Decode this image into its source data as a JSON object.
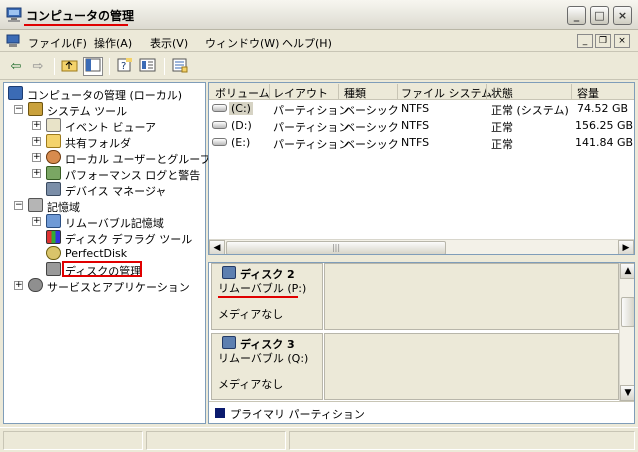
{
  "window": {
    "title": "コンピュータの管理"
  },
  "window_buttons": {
    "minimize": "_",
    "maximize": "□",
    "close": "×"
  },
  "menubar": {
    "items": [
      "ファイル(F)",
      "操作(A)",
      "表示(V)",
      "ウィンドウ(W)",
      "ヘルプ(H)"
    ]
  },
  "mdi_buttons": {
    "minimize": "_",
    "restore": "❐",
    "close": "×"
  },
  "toolbar": {
    "icons": [
      "back-arrow-icon",
      "forward-arrow-icon",
      "up-folder-icon",
      "show-tree-icon",
      "properties-icon",
      "help-icon",
      "export-icon"
    ]
  },
  "tree": {
    "root": "コンピュータの管理 (ローカル)",
    "system_tools": "システム ツール",
    "event_viewer": "イベント ビューア",
    "shared_folders": "共有フォルダ",
    "local_users": "ローカル ユーザーとグループ",
    "perf_logs": "パフォーマンス ログと警告",
    "device_manager": "デバイス マネージャ",
    "storage": "記憶域",
    "removable_storage": "リムーバブル記憶域",
    "defrag": "ディスク デフラグ ツール",
    "perfectdisk": "PerfectDisk",
    "disk_management": "ディスクの管理",
    "services_apps": "サービスとアプリケーション"
  },
  "volume_list": {
    "columns": [
      "ボリューム",
      "レイアウト",
      "種類",
      "ファイル システム",
      "状態",
      "容量"
    ],
    "rows": [
      [
        "(C:)",
        "パーティション",
        "ベーシック",
        "NTFS",
        "正常 (システム)",
        "74.52 GB"
      ],
      [
        "(D:)",
        "パーティション",
        "ベーシック",
        "NTFS",
        "正常",
        "156.25 GB"
      ],
      [
        "(E:)",
        "パーティション",
        "ベーシック",
        "NTFS",
        "正常",
        "141.84 GB"
      ]
    ],
    "scroll_grip": "|||"
  },
  "disks": [
    {
      "name": "ディスク 2",
      "type": "リムーバブル (P:)",
      "media": "メディアなし"
    },
    {
      "name": "ディスク 3",
      "type": "リムーバブル (Q:)",
      "media": "メディアなし"
    }
  ],
  "legend": {
    "label": "プライマリ パーティション",
    "color": "#0a1a6e"
  },
  "colors": {
    "highlight": "#e00000",
    "selection": "#316ac5"
  }
}
